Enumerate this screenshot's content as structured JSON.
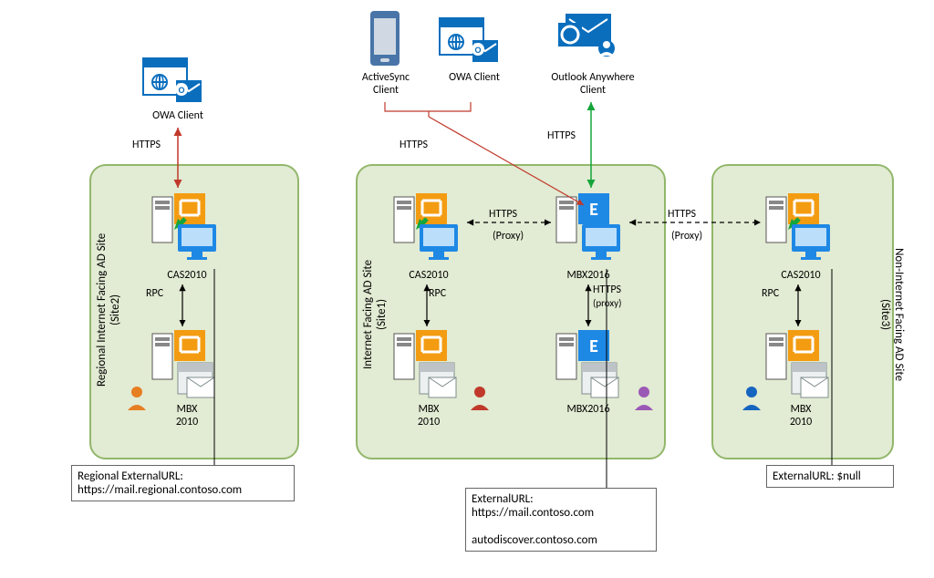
{
  "clients": {
    "owa_left": "OWA Client",
    "activesync": "ActiveSync\nClient",
    "owa_top": "OWA Client",
    "outlook_anywhere": "Outlook Anywhere\nClient"
  },
  "protocols": {
    "https": "HTTPS",
    "rpc": "RPC",
    "proxy": "(Proxy)",
    "https_proxy_small": "(proxy)"
  },
  "sites": {
    "site2": {
      "title": "Regional Internet Facing AD Site",
      "sub": "(Site2)"
    },
    "site1": {
      "title": "Internet Facing AD Site",
      "sub": "(Site1)"
    },
    "site3": {
      "title": "Non-Internet Facing AD Site",
      "sub": "(Site3)"
    }
  },
  "servers": {
    "cas2010": "CAS2010",
    "mbx2010": "MBX\n2010",
    "mbx2016": "MBX2016"
  },
  "callouts": {
    "regional": "Regional ExternalURL:\nhttps://mail.regional.contoso.com",
    "central": "ExternalURL:\nhttps://mail.contoso.com\n\nautodiscover.contoso.com",
    "right": "ExternalURL: $null"
  },
  "colors": {
    "red": "#c0392b",
    "green": "#15a53a",
    "blue": "#0a6ebd",
    "purple": "#9b59b6",
    "orange": "#e67e22"
  }
}
